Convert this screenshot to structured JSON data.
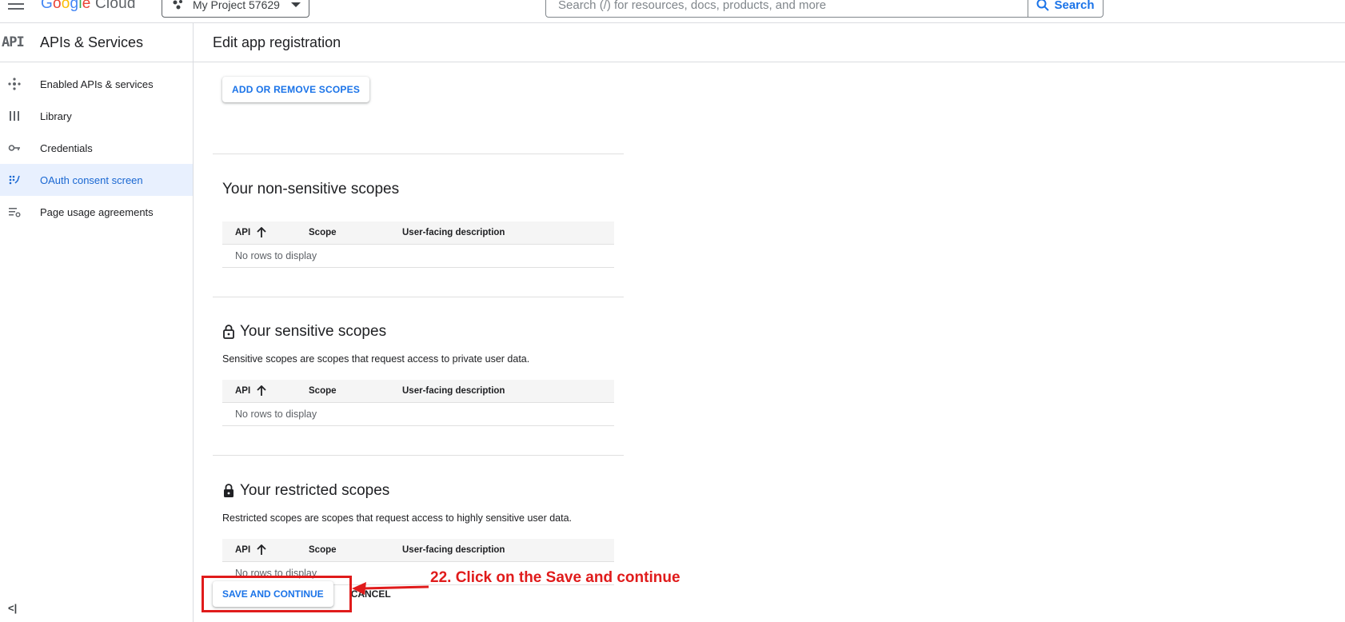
{
  "topbar": {
    "logo": {
      "g": "G",
      "o1": "o",
      "o2": "o",
      "g2": "g",
      "l": "l",
      "e": "e",
      "cloud": " Cloud"
    },
    "project": "My Project 57629",
    "search_placeholder": "Search (/) for resources, docs, products, and more",
    "search_button": "Search"
  },
  "sidebar": {
    "badge": "API",
    "title": "APIs & Services",
    "items": [
      {
        "label": "Enabled APIs & services",
        "icon": "hub-icon"
      },
      {
        "label": "Library",
        "icon": "library-icon"
      },
      {
        "label": "Credentials",
        "icon": "key-icon"
      },
      {
        "label": "OAuth consent screen",
        "icon": "consent-icon",
        "active": true
      },
      {
        "label": "Page usage agreements",
        "icon": "settings-list-icon"
      }
    ],
    "collapse": "<|"
  },
  "main": {
    "page_title": "Edit app registration",
    "add_remove_scopes": "ADD OR REMOVE SCOPES",
    "columns": {
      "api": "API",
      "scope": "Scope",
      "description": "User-facing description"
    },
    "empty_text": "No rows to display",
    "non_sensitive": {
      "title": "Your non-sensitive scopes"
    },
    "sensitive": {
      "title": "Your sensitive scopes",
      "description": "Sensitive scopes are scopes that request access to private user data."
    },
    "restricted": {
      "title": "Your restricted scopes",
      "description": "Restricted scopes are scopes that request access to highly sensitive user data."
    },
    "save_button": "SAVE AND CONTINUE",
    "cancel_button": "CANCEL"
  },
  "annotation": {
    "text": "22. Click on the Save and continue",
    "color": "#e01b1b"
  },
  "colors": {
    "accent": "#1a73e8",
    "active_bg": "#e8f0fe"
  }
}
